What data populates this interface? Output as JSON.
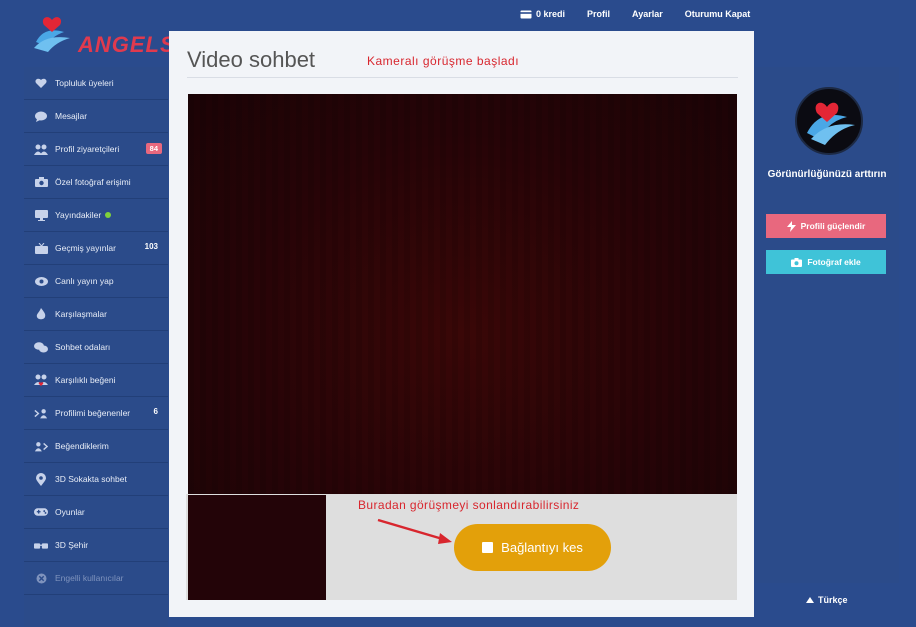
{
  "topnav": {
    "credits": "0 kredi",
    "profile": "Profil",
    "settings": "Ayarlar",
    "logout": "Oturumu Kapat"
  },
  "logo_text": "ANGELS",
  "sidebar": {
    "items": [
      {
        "label": "Topluluk üyeleri",
        "icon": "heart-icon"
      },
      {
        "label": "Mesajlar",
        "icon": "chat-bubble-icon"
      },
      {
        "label": "Profil ziyaretçileri",
        "icon": "users-icon",
        "badge": "84"
      },
      {
        "label": "Özel fotoğraf erişimi",
        "icon": "camera-icon"
      },
      {
        "label": "Yayındakiler",
        "icon": "monitor-icon",
        "online_dot": true
      },
      {
        "label": "Geçmiş yayınlar",
        "icon": "tv-icon",
        "count": "103"
      },
      {
        "label": "Canlı yayın yap",
        "icon": "eye-icon"
      },
      {
        "label": "Karşılaşmalar",
        "icon": "flame-icon"
      },
      {
        "label": "Sohbet odaları",
        "icon": "chat-bubbles-icon"
      },
      {
        "label": "Karşılıklı beğeni",
        "icon": "mutual-like-icon"
      },
      {
        "label": "Profilimi beğenenler",
        "icon": "liked-me-icon",
        "count": "6"
      },
      {
        "label": "Beğendiklerim",
        "icon": "my-likes-icon"
      },
      {
        "label": "3D Sokakta sohbet",
        "icon": "map-pin-icon"
      },
      {
        "label": "Oyunlar",
        "icon": "gamepad-icon"
      },
      {
        "label": "3D Şehir",
        "icon": "3d-glasses-icon"
      },
      {
        "label": "Engelli kullanıcılar",
        "icon": "blocked-icon",
        "dim": true
      }
    ]
  },
  "main": {
    "title": "Video sohbet",
    "status": "Kameralı görüşme başladı",
    "hint": "Buradan görüşmeyi sonlandırabilirsiniz",
    "disconnect_label": "Bağlantıyı kes"
  },
  "right_panel": {
    "visibility_text": "Görünürlüğünüzü arttırın",
    "boost_label": "Profili güçlendir",
    "add_photo_label": "Fotoğraf ekle"
  },
  "language": "Türkçe",
  "colors": {
    "background": "#2a4b8d",
    "accent_red": "#d8262e",
    "pink": "#e8687e",
    "cyan": "#3fc3d8",
    "orange": "#e3a00a"
  }
}
